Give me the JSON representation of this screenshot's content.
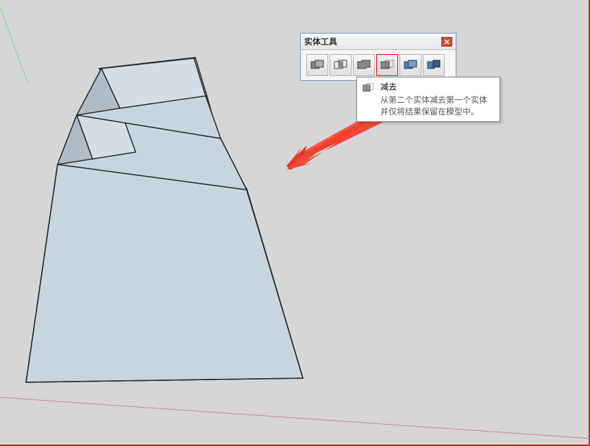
{
  "toolbar": {
    "title": "实体工具",
    "buttons": [
      {
        "name": "outer-shell",
        "selected": false
      },
      {
        "name": "intersect",
        "selected": false
      },
      {
        "name": "union",
        "selected": false
      },
      {
        "name": "subtract",
        "selected": true
      },
      {
        "name": "trim",
        "selected": false
      },
      {
        "name": "split",
        "selected": false
      }
    ]
  },
  "tooltip": {
    "title": "减去",
    "description": "从第二个实体减去第一个实体并仅将结果保留在模型中。"
  },
  "colors": {
    "annotation": "#ff0000",
    "arrow": "#f04a3a",
    "model_face": "#c7d6e0",
    "model_edge": "#2a2a2a",
    "ground": "#d6d6d6"
  }
}
